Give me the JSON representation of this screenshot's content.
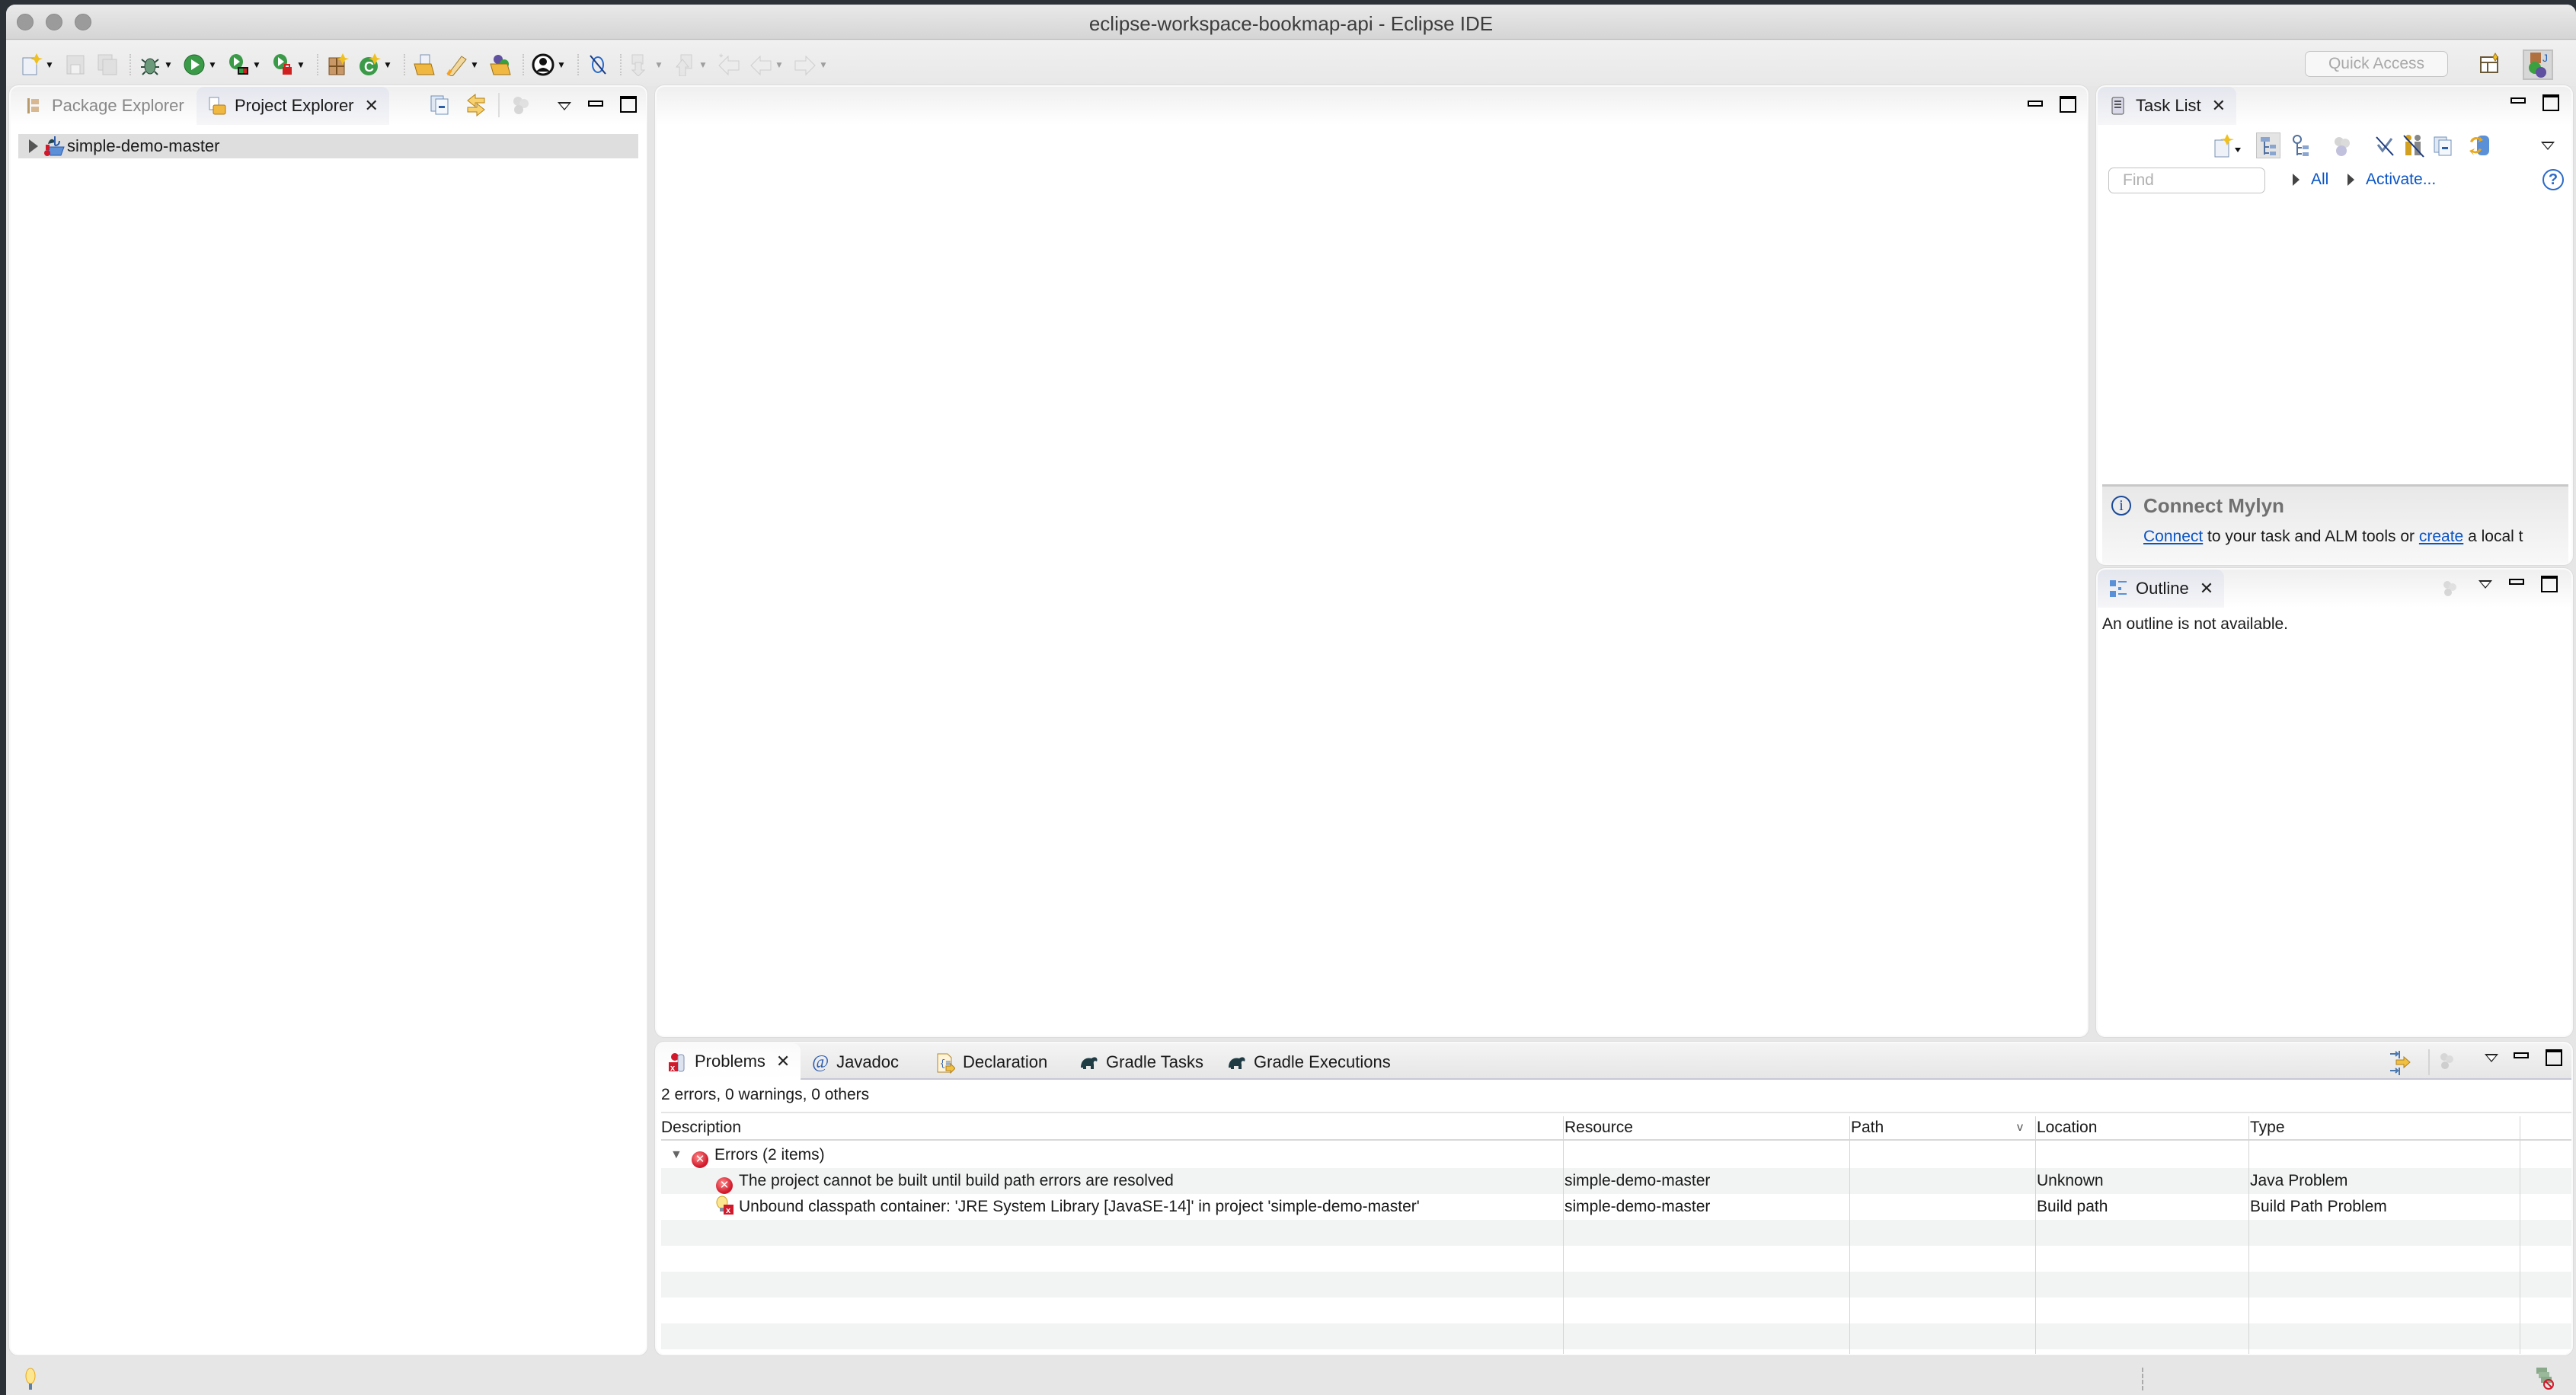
{
  "window": {
    "title": "eclipse-workspace-bookmap-api - Eclipse IDE"
  },
  "toolbar": {
    "items": [
      {
        "icon": "new-wizard-icon",
        "dropdown": true,
        "enabled": true
      },
      {
        "icon": "save-icon",
        "dropdown": false,
        "enabled": false
      },
      {
        "icon": "save-all-icon",
        "dropdown": false,
        "enabled": false
      },
      {
        "icon": "debug-icon",
        "dropdown": true,
        "enabled": true
      },
      {
        "icon": "run-icon",
        "dropdown": true,
        "enabled": true
      },
      {
        "icon": "coverage-icon",
        "dropdown": true,
        "enabled": true
      },
      {
        "icon": "run-external-tools-icon",
        "dropdown": true,
        "enabled": true
      },
      {
        "icon": "new-java-package-icon",
        "dropdown": false,
        "enabled": true
      },
      {
        "icon": "new-java-class-icon",
        "dropdown": true,
        "enabled": true
      },
      {
        "icon": "open-type-icon",
        "dropdown": false,
        "enabled": true
      },
      {
        "icon": "open-task-icon",
        "dropdown": true,
        "enabled": true
      },
      {
        "icon": "open-project-icon",
        "dropdown": false,
        "enabled": true
      },
      {
        "icon": "account-icon",
        "dropdown": true,
        "enabled": true
      },
      {
        "icon": "toggle-mark-occurrences-icon",
        "dropdown": false,
        "enabled": true
      },
      {
        "icon": "next-annotation-icon",
        "dropdown": true,
        "enabled": false
      },
      {
        "icon": "previous-annotation-icon",
        "dropdown": true,
        "enabled": false
      },
      {
        "icon": "last-edit-location-icon",
        "dropdown": false,
        "enabled": false
      },
      {
        "icon": "back-icon",
        "dropdown": true,
        "enabled": false
      },
      {
        "icon": "forward-icon",
        "dropdown": true,
        "enabled": false
      }
    ],
    "quick_access_placeholder": "Quick Access"
  },
  "left_panel": {
    "tabs": [
      {
        "label": "Package Explorer",
        "icon": "package-explorer-icon",
        "active": false
      },
      {
        "label": "Project Explorer",
        "icon": "project-explorer-icon",
        "active": true
      }
    ],
    "tree": [
      {
        "label": "simple-demo-master",
        "icon": "gradle-java-project-error-icon",
        "expanded": false,
        "selected": true
      }
    ]
  },
  "task_list": {
    "tab_label": "Task List",
    "find_placeholder": "Find",
    "all_label": "All",
    "activate_label": "Activate...",
    "mylyn": {
      "title": "Connect Mylyn",
      "connect_link": "Connect",
      "middle_text": " to your task and ALM tools or ",
      "create_link": "create",
      "tail_text": " a local t"
    }
  },
  "outline": {
    "tab_label": "Outline",
    "message": "An outline is not available."
  },
  "bottom_panel": {
    "tabs": [
      {
        "label": "Problems",
        "icon": "problems-icon",
        "active": true
      },
      {
        "label": "Javadoc",
        "icon": "javadoc-at-icon",
        "active": false
      },
      {
        "label": "Declaration",
        "icon": "declaration-icon",
        "active": false
      },
      {
        "label": "Gradle Tasks",
        "icon": "gradle-elephant-icon",
        "active": false
      },
      {
        "label": "Gradle Executions",
        "icon": "gradle-elephant-icon",
        "active": false
      }
    ],
    "summary": "2 errors, 0 warnings, 0 others",
    "columns": [
      "Description",
      "Resource",
      "Path",
      "Location",
      "Type"
    ],
    "group": {
      "label": "Errors (2 items)",
      "expanded": true
    },
    "rows": [
      {
        "icon": "error-icon",
        "description": "The project cannot be built until build path errors are resolved",
        "resource": "simple-demo-master",
        "path": "",
        "location": "Unknown",
        "type": "Java Problem"
      },
      {
        "icon": "quickfix-error-icon",
        "description": "Unbound classpath container: 'JRE System Library [JavaSE-14]' in project 'simple-demo-master'",
        "resource": "simple-demo-master",
        "path": "",
        "location": "Build path",
        "type": "Build Path Problem"
      }
    ]
  }
}
